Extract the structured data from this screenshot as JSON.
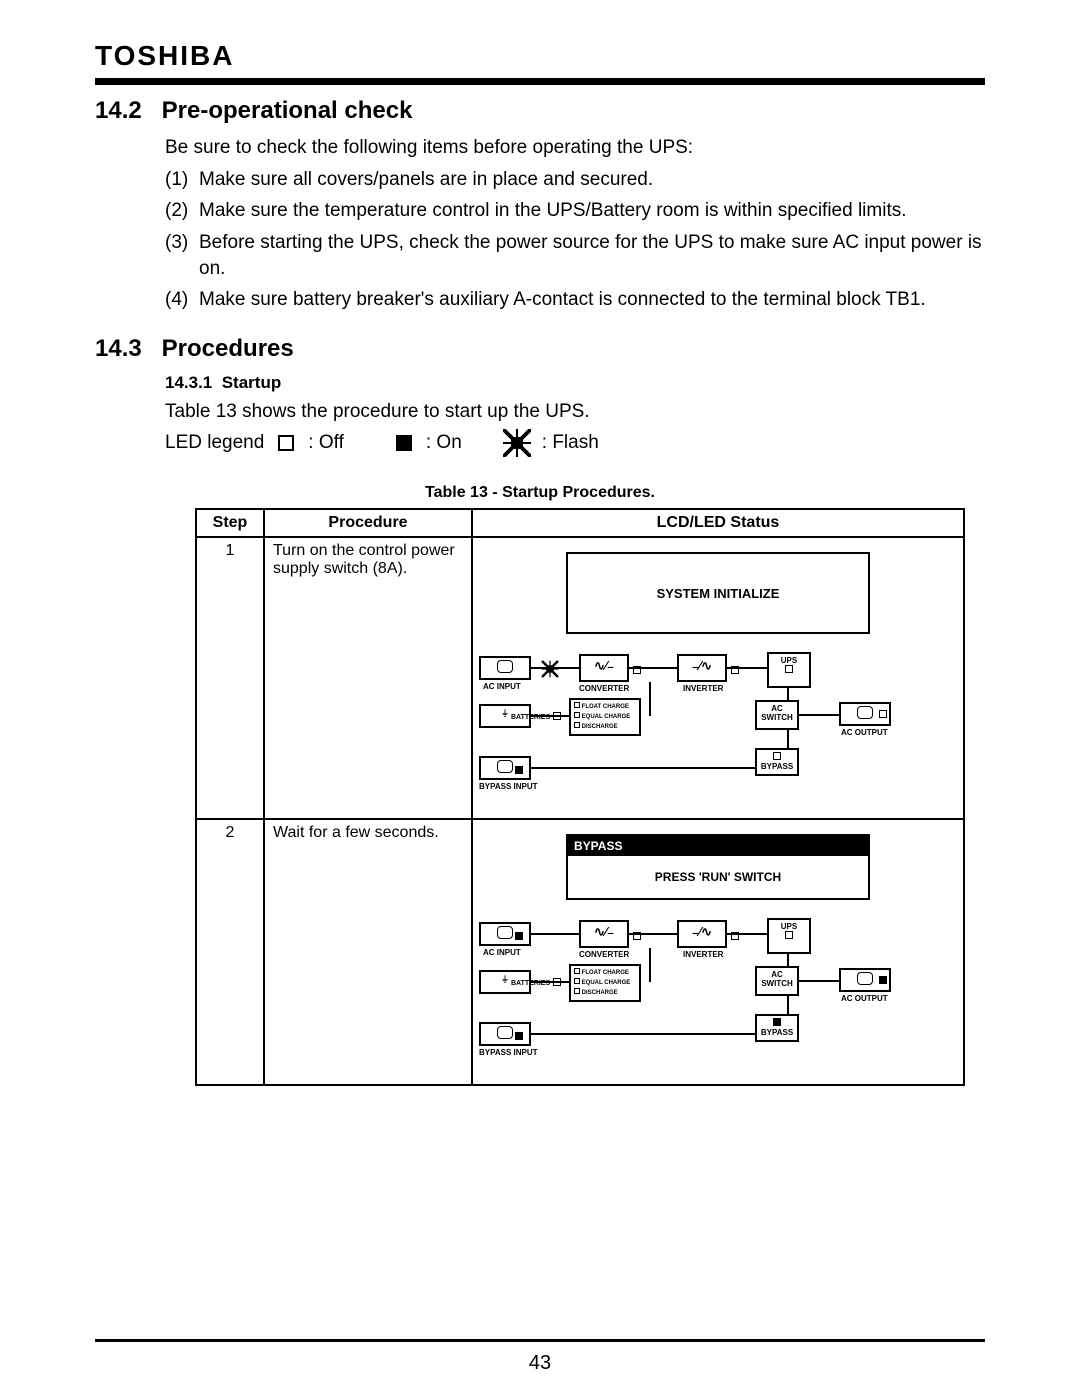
{
  "brand": "TOSHIBA",
  "page_number": "43",
  "sections": {
    "s142": {
      "number": "14.2",
      "title": "Pre-operational check",
      "intro": "Be sure to check the following items before operating the UPS:",
      "items": [
        {
          "n": "(1)",
          "t": "Make sure all covers/panels are in place and secured."
        },
        {
          "n": "(2)",
          "t": "Make sure the temperature control in the UPS/Battery room is within specified limits."
        },
        {
          "n": "(3)",
          "t": "Before starting the UPS, check the power source for the UPS to make sure AC input power is on."
        },
        {
          "n": "(4)",
          "t": "Make sure battery breaker's auxiliary A-contact is connected to the terminal block TB1."
        }
      ]
    },
    "s143": {
      "number": "14.3",
      "title": "Procedures",
      "sub_number": "14.3.1",
      "sub_title": "Startup",
      "line": "Table 13 shows the procedure to start up the UPS.",
      "legend": {
        "label": "LED legend",
        "off": ": Off",
        "on": ": On",
        "flash": ": Flash"
      }
    }
  },
  "table": {
    "caption": "Table 13 - Startup Procedures.",
    "headers": {
      "step": "Step",
      "proc": "Procedure",
      "lcd": "LCD/LED Status"
    },
    "rows": [
      {
        "step": "1",
        "proc": "Turn on the control power supply switch (8A).",
        "lcd_text": "SYSTEM INITIALIZE"
      },
      {
        "step": "2",
        "proc": "Wait for a few seconds.",
        "lcd_bar": "BYPASS",
        "lcd_msg": "PRESS 'RUN' SWITCH"
      }
    ]
  },
  "diagram_labels": {
    "ac_input": "AC INPUT",
    "converter": "CONVERTER",
    "inverter": "INVERTER",
    "ups": "UPS",
    "ac_switch_1": "AC",
    "ac_switch_2": "SWITCH",
    "ac_output": "AC OUTPUT",
    "batteries": "BATTERIES",
    "float": "FLOAT CHARGE",
    "equal": "EQUAL CHARGE",
    "discharge": "DISCHARGE",
    "bypass_input": "BYPASS INPUT",
    "bypass": "BYPASS"
  }
}
